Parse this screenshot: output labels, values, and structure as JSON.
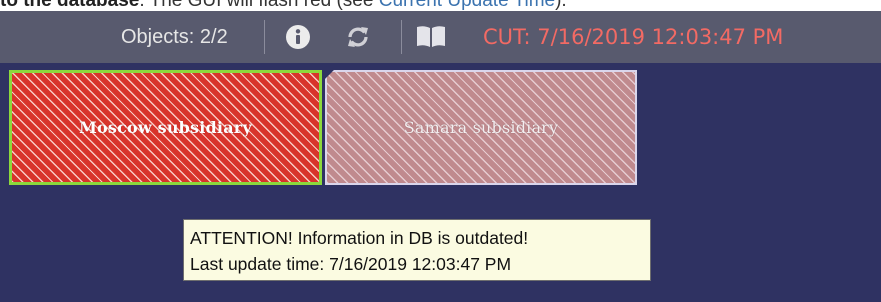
{
  "doc_header": {
    "bold_text": "to the database",
    "middle_text": ". The GUI will flash red (see ",
    "link_text": "Current Update Time",
    "end_text": ")."
  },
  "toolbar": {
    "objects_label": "Objects: 2/2",
    "cut_label": "CUT: 7/16/2019 12:03:47 PM",
    "icons": [
      "info-icon",
      "refresh-icon",
      "book-icon"
    ],
    "cut_color": "#f26a64"
  },
  "map": {
    "background_color": "#2f3262",
    "objects": [
      {
        "label": "Moscow subsidiary",
        "state": "selected",
        "fill_color": "#d8342b",
        "border_color": "#8cd83c"
      },
      {
        "label": "Samara subsidiary",
        "state": "not selected",
        "fill_color": "#c08a8e",
        "border_color": "#dad6ec"
      }
    ]
  },
  "tooltip": {
    "line1": "ATTENTION! Information in DB is outdated!",
    "line2": "Last update time: 7/16/2019 12:03:47 PM"
  }
}
